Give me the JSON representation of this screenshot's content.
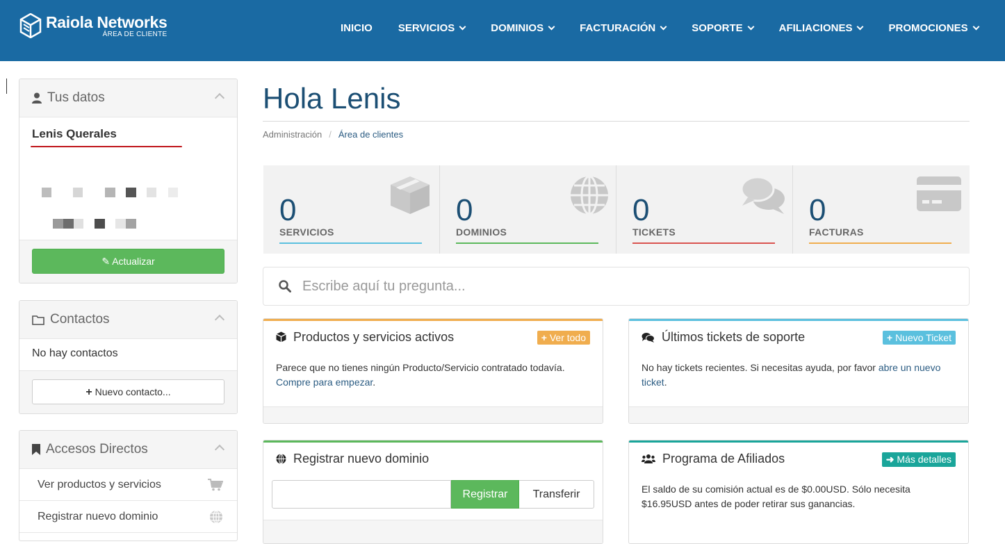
{
  "brand": {
    "name": "Raiola Networks",
    "subtitle": "ÁREA DE CLIENTE"
  },
  "nav": [
    {
      "label": "INICIO",
      "dropdown": false
    },
    {
      "label": "SERVICIOS",
      "dropdown": true
    },
    {
      "label": "DOMINIOS",
      "dropdown": true
    },
    {
      "label": "FACTURACIÓN",
      "dropdown": true
    },
    {
      "label": "SOPORTE",
      "dropdown": true
    },
    {
      "label": "AFILIACIONES",
      "dropdown": true
    },
    {
      "label": "PROMOCIONES",
      "dropdown": true
    }
  ],
  "sidebar": {
    "profile": {
      "title": "Tus datos",
      "name": "Lenis Querales",
      "update_label": "Actualizar"
    },
    "contacts": {
      "title": "Contactos",
      "empty_text": "No hay contactos",
      "new_label": "Nuevo contacto..."
    },
    "shortcuts": {
      "title": "Accesos Directos",
      "items": [
        {
          "label": "Ver productos y servicios",
          "icon": "cart-icon"
        },
        {
          "label": "Registrar nuevo dominio",
          "icon": "globe-icon"
        }
      ]
    }
  },
  "main": {
    "greeting": "Hola Lenis",
    "breadcrumb": {
      "parent": "Administración",
      "separator": "/",
      "current": "Área de clientes"
    },
    "stats": [
      {
        "value": "0",
        "label": "SERVICIOS",
        "color": "#5bc0de",
        "icon": "box-icon"
      },
      {
        "value": "0",
        "label": "DOMINIOS",
        "color": "#5cb85c",
        "icon": "globe-icon"
      },
      {
        "value": "0",
        "label": "TICKETS",
        "color": "#d9534f",
        "icon": "comments-icon"
      },
      {
        "value": "0",
        "label": "FACTURAS",
        "color": "#f0ad4e",
        "icon": "credit-card-icon"
      }
    ],
    "search_placeholder": "Escribe aquí tu pregunta...",
    "cards": {
      "products": {
        "title": "Productos y servicios activos",
        "badge": "Ver todo",
        "text": "Parece que no tienes ningún Producto/Servicio contratado todavía.",
        "link": "Compre para empezar",
        "trail": "."
      },
      "tickets": {
        "title": "Últimos tickets de soporte",
        "badge": "Nuevo Ticket",
        "text": "No hay tickets recientes. Si necesitas ayuda, por favor",
        "link": "abre un nuevo ticket",
        "trail": "."
      },
      "domain": {
        "title": "Registrar nuevo dominio",
        "register_label": "Registrar",
        "transfer_label": "Transferir"
      },
      "affiliates": {
        "title": "Programa de Afiliados",
        "badge": "Más detalles",
        "text": "El saldo de su comisión actual es de $0.00USD. Sólo necesita $16.95USD antes de poder retirar sus ganancias."
      }
    }
  },
  "colors": {
    "header": "#1a6aa3",
    "title": "#1c4f74",
    "green": "#5cb85c",
    "orange": "#f0ad4e",
    "info": "#5bc0de",
    "teal": "#1abc9c"
  }
}
